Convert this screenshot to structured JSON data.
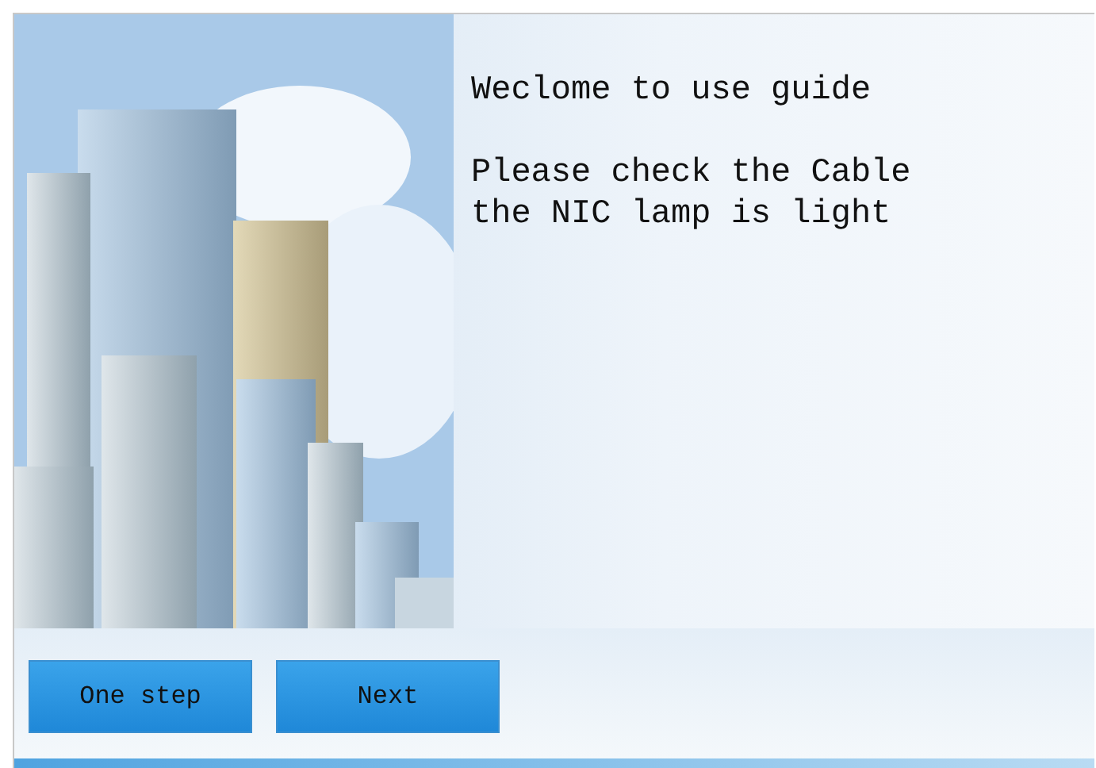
{
  "welcome": "Weclome to use guide",
  "instructions": [
    "Please check the Cable",
    "the NIC lamp is light"
  ],
  "buttons": [
    {
      "label": "One step"
    },
    {
      "label": "Next"
    }
  ]
}
